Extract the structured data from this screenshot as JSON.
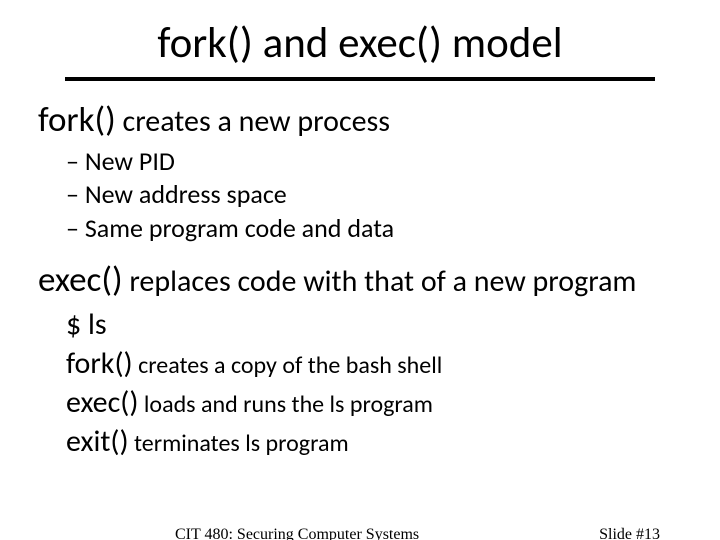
{
  "title": "fork() and exec() model",
  "section1": {
    "heading_mono": "fork()",
    "heading_rest": " creates a new process",
    "items": [
      "New PID",
      "New address space",
      "Same program code and data"
    ]
  },
  "section2": {
    "heading_mono": "exec()",
    "heading_rest": " replaces code with that of a new program",
    "lines": [
      {
        "mono": "$ ls",
        "rest": ""
      },
      {
        "mono": "fork()",
        "rest": " creates a copy of the bash shell"
      },
      {
        "mono": "exec()",
        "rest": " loads and runs the ls program"
      },
      {
        "mono": "exit()",
        "rest": " terminates ls program"
      }
    ]
  },
  "footer": {
    "course": "CIT 480: Securing Computer Systems",
    "slide": "Slide #13"
  }
}
